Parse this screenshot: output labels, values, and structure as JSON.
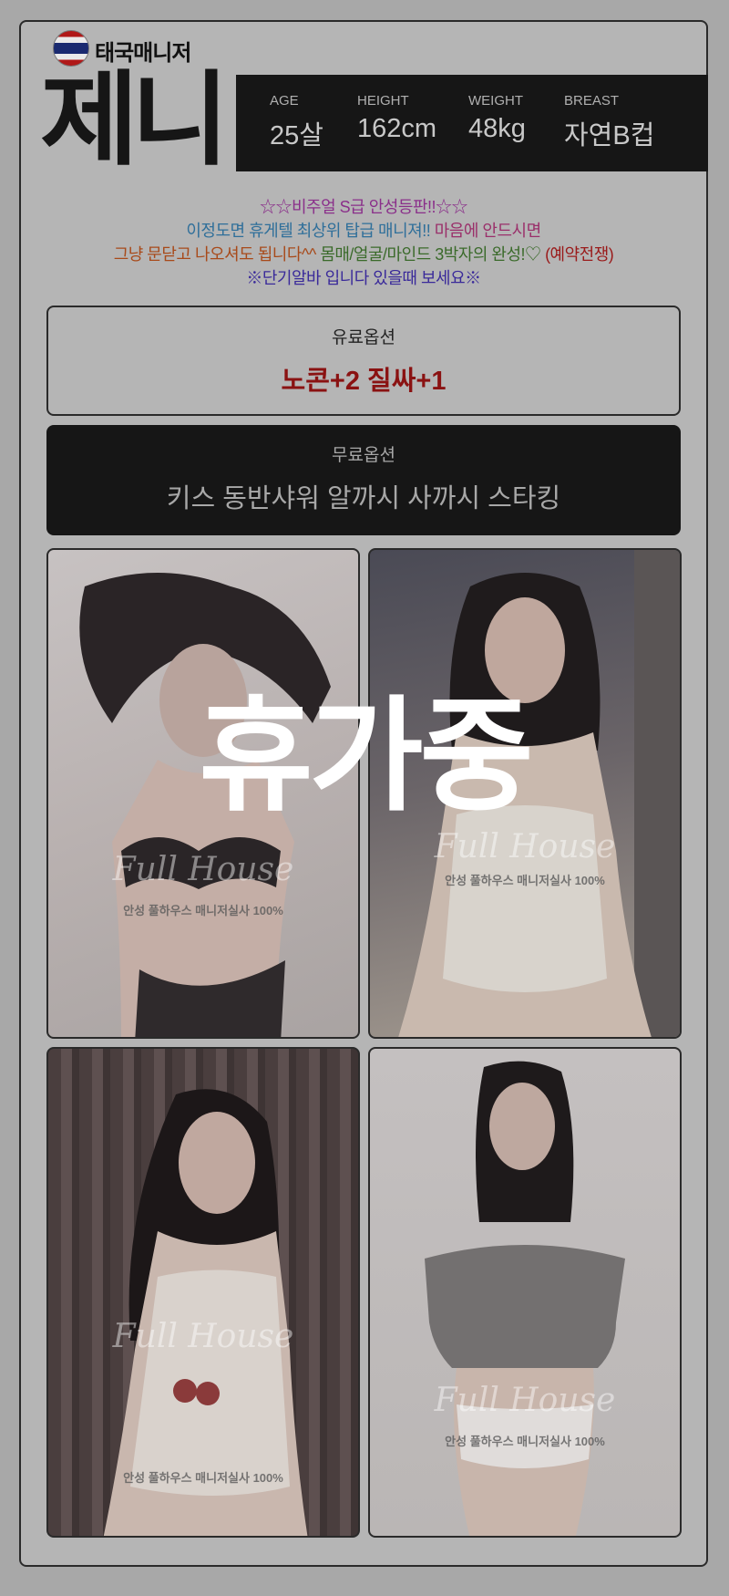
{
  "profile": {
    "nationality": "태국매니저",
    "name": "제니",
    "specs": [
      {
        "label": "AGE",
        "value": "25살"
      },
      {
        "label": "HEIGHT",
        "value": "162cm"
      },
      {
        "label": "WEIGHT",
        "value": "48kg"
      },
      {
        "label": "BREAST",
        "value": "자연B컵"
      }
    ]
  },
  "intro": {
    "line1": "☆☆비주얼 S급 안성등판!!☆☆",
    "line2a": "이정도면 휴게텔 최상위 탑급 매니져!!",
    "line2b": " 마음에 안드시면",
    "line3a": "그냥 문닫고 나오셔도 됩니다^^",
    "line3b": " 몸매/얼굴/마인드 3박자의 완성!♡",
    "line3c": " (예약전쟁)",
    "line4": "※단기알바 입니다 있을때 보세요※",
    "colors": {
      "line1": "#8a2f8a",
      "line2a": "#2f6f9a",
      "line2b": "#9a2f6a",
      "line3a": "#a84a1a",
      "line3b": "#3a6a2a",
      "line3c": "#9a1a1a",
      "line4": "#3a2a9a"
    }
  },
  "options": {
    "paid_title": "유료옵션",
    "paid_value": "노콘+2 질싸+1",
    "free_title": "무료옵션",
    "free_value": "키스 동반샤워 알까시 사까시 스타킹"
  },
  "photos": [
    {
      "watermark": "Full House",
      "caption": "안성 풀하우스 매니저실사 100%"
    },
    {
      "watermark": "Full House",
      "caption": "안성 풀하우스 매니저실사 100%"
    },
    {
      "watermark": "Full House",
      "caption": "안성 풀하우스 매니저실사 100%"
    },
    {
      "watermark": "Full House",
      "caption": "안성 풀하우스 매니저실사 100%"
    }
  ],
  "status_overlay": "휴가중",
  "colors": {
    "accent_red": "#8a1212",
    "dark_bg": "#161616",
    "dim_overlay": "#a8a8a8"
  }
}
